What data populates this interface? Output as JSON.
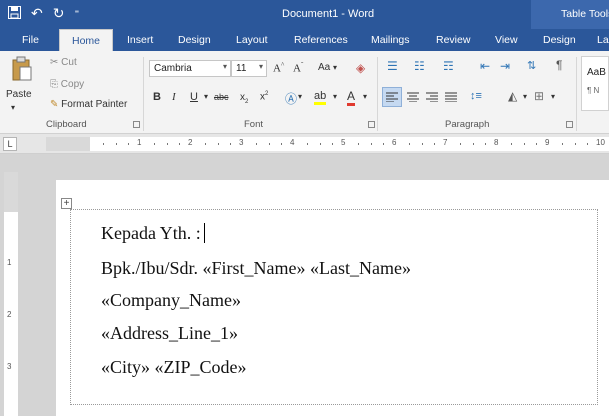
{
  "titlebar": {
    "document_title": "Document1 - Word",
    "context_title": "Table Tools"
  },
  "tabs": [
    {
      "label": "File"
    },
    {
      "label": "Home"
    },
    {
      "label": "Insert"
    },
    {
      "label": "Design"
    },
    {
      "label": "Layout"
    },
    {
      "label": "References"
    },
    {
      "label": "Mailings"
    },
    {
      "label": "Review"
    },
    {
      "label": "View"
    },
    {
      "label": "Design"
    },
    {
      "label": "La"
    }
  ],
  "ribbon": {
    "clipboard": {
      "paste": "Paste",
      "cut": "Cut",
      "copy": "Copy",
      "format_painter": "Format Painter",
      "group_label": "Clipboard"
    },
    "font": {
      "font_name": "Cambria",
      "font_size": "11",
      "change_case": "Aa",
      "group_label": "Font"
    },
    "paragraph": {
      "group_label": "Paragraph"
    },
    "styles": {
      "preview": "AaB",
      "normal": "¶ N"
    }
  },
  "ruler": {
    "numbers": [
      "1",
      "2",
      "3",
      "4",
      "5",
      "6",
      "7",
      "8",
      "9",
      "10"
    ],
    "vertical_numbers": [
      "1",
      "2",
      "3"
    ]
  },
  "document": {
    "lines": [
      "Kepada Yth. :",
      "Bpk./Ibu/Sdr. «First_Name» «Last_Name»",
      "«Company_Name»",
      "«Address_Line_1»",
      "«City» «ZIP_Code»"
    ]
  }
}
